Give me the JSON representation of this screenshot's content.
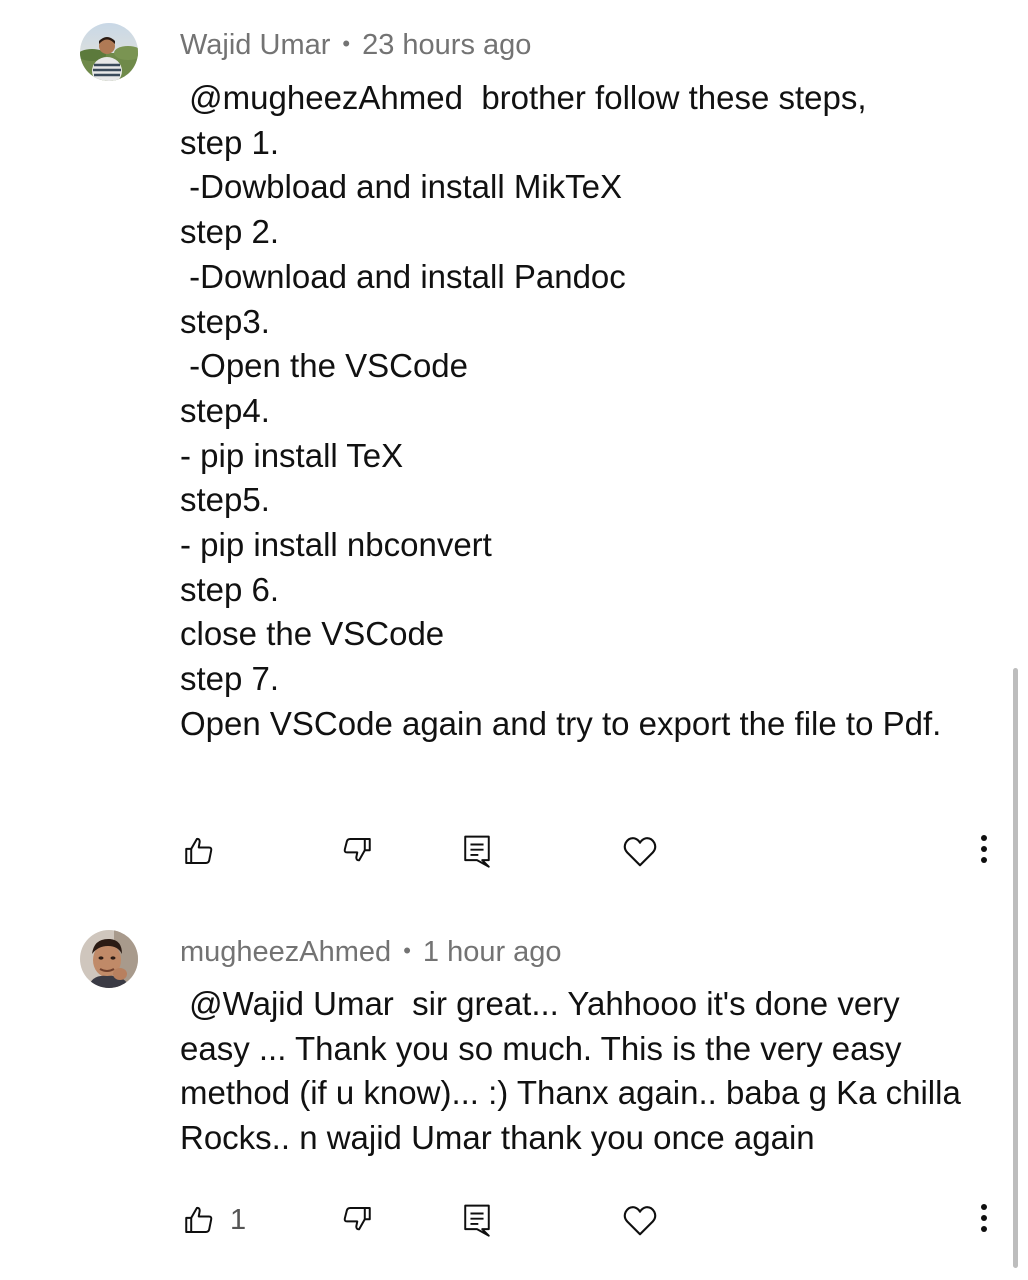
{
  "comments": [
    {
      "author": "Wajid Umar",
      "time": "23 hours ago",
      "text": " @mugheezAhmed  brother follow these steps,\nstep 1.\n -Dowbload and install MikTeX\nstep 2.\n -Download and install Pandoc\nstep3.\n -Open the VSCode\nstep4.\n- pip install TeX\nstep5.\n- pip install nbconvert\nstep 6.\nclose the VSCode\nstep 7.\nOpen VSCode again and try to export the file to Pdf.",
      "like_count": "",
      "icons": [
        "thumbs-up-icon",
        "thumbs-down-icon",
        "reply-icon",
        "heart-icon",
        "more-vertical-icon"
      ]
    },
    {
      "author": "mugheezAhmed",
      "time": "1 hour ago",
      "text": " @Wajid Umar  sir great... Yahhooo it's done very easy ... Thank you so much. This is the very easy method (if u know)... :) Thanx again.. baba g Ka chilla Rocks.. n wajid Umar thank you once again",
      "like_count": "1",
      "icons": [
        "thumbs-up-icon",
        "thumbs-down-icon",
        "reply-icon",
        "heart-icon",
        "more-vertical-icon"
      ]
    }
  ],
  "colors": {
    "meta_text": "#737373",
    "body_text": "#111111",
    "icon_stroke": "#0f0f0f",
    "scrollbar": "#bdbdbd"
  }
}
